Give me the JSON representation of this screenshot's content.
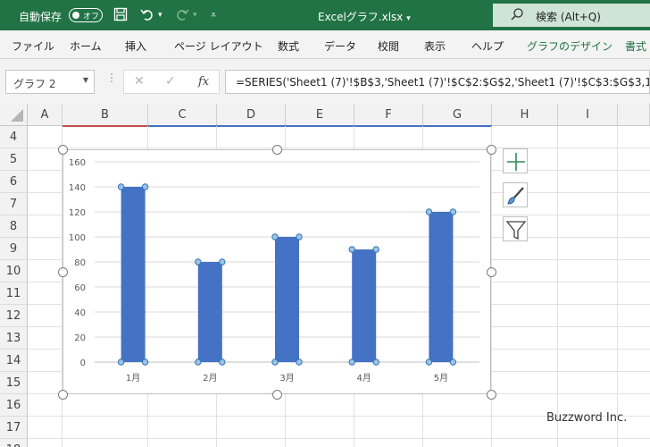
{
  "titlebar": {
    "autosave_label": "自動保存",
    "autosave_state": "オフ",
    "filename": "Excelグラフ.xlsx",
    "filename_arrow": "▾",
    "search_label": "検索 (Alt+Q)",
    "icons": [
      "save-icon",
      "undo-icon",
      "redo-icon",
      "customize-icon",
      "search-icon"
    ]
  },
  "ribbon": {
    "tabs": [
      "ファイル",
      "ホーム",
      "挿入",
      "ページ レイアウト",
      "数式",
      "データ",
      "校閲",
      "表示",
      "ヘルプ",
      "グラフのデザイン",
      "書式"
    ]
  },
  "formula_bar": {
    "name_box": "グラフ 2",
    "formula": "=SERIES('Sheet1 (7)'!$B$3,'Sheet1 (7)'!$C$2:$G$2,'Sheet1 (7)'!$C$3:$G$3,1)"
  },
  "grid": {
    "columns": [
      "A",
      "B",
      "C",
      "D",
      "E",
      "F",
      "G",
      "H",
      "I"
    ],
    "rows": [
      "4",
      "5",
      "6",
      "7",
      "8",
      "9",
      "10",
      "11",
      "12",
      "13",
      "14",
      "15",
      "16",
      "17",
      "18"
    ]
  },
  "chart_data": {
    "type": "bar",
    "categories": [
      "1月",
      "2月",
      "3月",
      "4月",
      "5月"
    ],
    "values": [
      140,
      80,
      100,
      90,
      120
    ],
    "ylim": [
      0,
      160
    ],
    "yticks": [
      "0",
      "20",
      "40",
      "60",
      "80",
      "100",
      "120",
      "140",
      "160"
    ],
    "bar_color": "#4472c4",
    "grid": true
  },
  "chart_tools": {
    "buttons": [
      "chart-elements-plus-icon",
      "chart-styles-brush-icon",
      "chart-filters-funnel-icon"
    ]
  },
  "watermark": "Buzzword Inc.",
  "colors": {
    "accent": "#217346",
    "bar": "#4472c4"
  }
}
